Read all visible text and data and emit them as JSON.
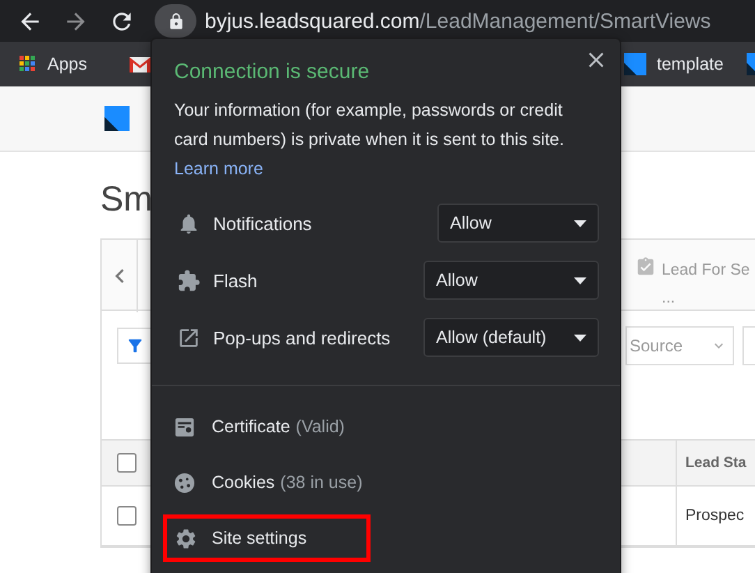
{
  "toolbar": {
    "url_host": "byjus.leadsquared.com",
    "url_path": "/LeadManagement/SmartViews"
  },
  "bookmarks": [
    {
      "kind": "apps",
      "label": "Apps"
    },
    {
      "kind": "mail"
    },
    {
      "kind": "logo",
      "label": "template"
    },
    {
      "kind": "logo"
    }
  ],
  "page": {
    "heading": "Sm",
    "tab": {
      "label": "Lead For Se",
      "more": "..."
    },
    "filter": {
      "value": "Source"
    },
    "column": "Lead Sta",
    "header_checked": false,
    "rows": [
      {
        "checked": false,
        "cell": "Prospec"
      }
    ]
  },
  "popup": {
    "title": "Connection is secure",
    "description": "Your information (for example, passwords or credit card numbers) is private when it is sent to this site.",
    "learn_more": "Learn more",
    "permissions": [
      {
        "label": "Notifications",
        "value": "Allow"
      },
      {
        "label": "Flash",
        "value": "Allow"
      },
      {
        "label": "Pop-ups and redirects",
        "value": "Allow (default)"
      }
    ],
    "items": [
      {
        "label": "Certificate",
        "detail": "(Valid)",
        "highlighted": false
      },
      {
        "label": "Cookies",
        "detail": "(38 in use)",
        "highlighted": false
      },
      {
        "label": "Site settings",
        "highlighted": true
      }
    ]
  }
}
